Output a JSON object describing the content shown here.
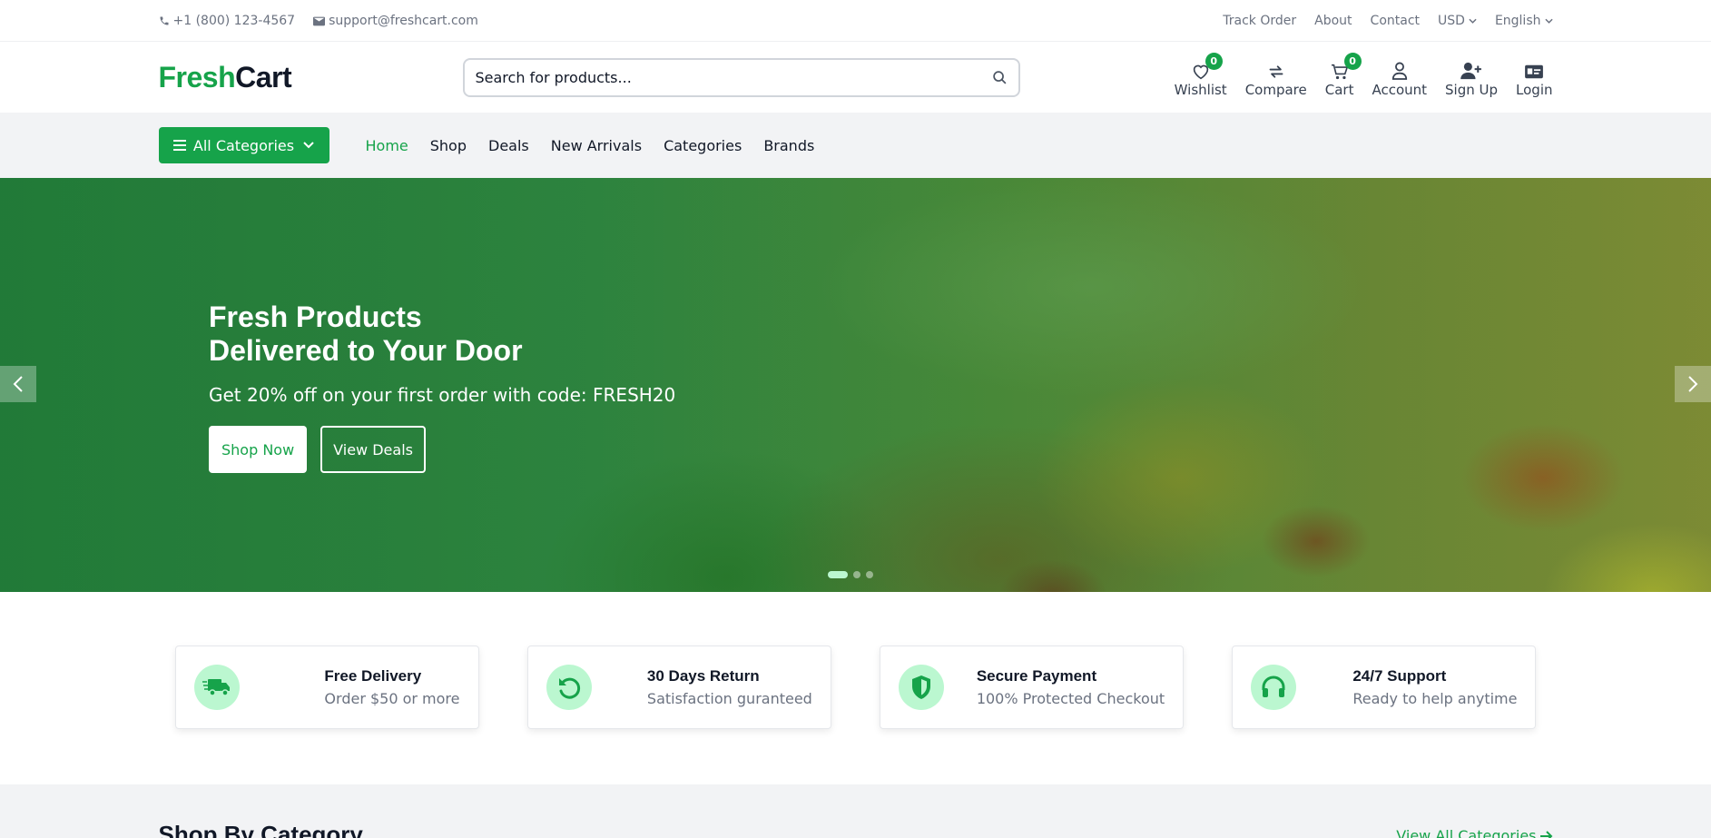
{
  "topbar": {
    "phone": "+1 (800) 123-4567",
    "email": "support@freshcart.com",
    "links": [
      "Track Order",
      "About",
      "Contact"
    ],
    "currency": "USD",
    "language": "English"
  },
  "header": {
    "logo_part1": "Fresh",
    "logo_part2": "Cart",
    "search_placeholder": "Search for products...",
    "icons": {
      "wishlist": {
        "label": "Wishlist",
        "count": "0"
      },
      "compare": {
        "label": "Compare"
      },
      "cart": {
        "label": "Cart",
        "count": "0"
      },
      "account": {
        "label": "Account"
      },
      "signup": {
        "label": "Sign Up"
      },
      "login": {
        "label": "Login"
      }
    }
  },
  "nav": {
    "all_categories": "All Categories",
    "links": [
      "Home",
      "Shop",
      "Deals",
      "New Arrivals",
      "Categories",
      "Brands"
    ],
    "active": "Home"
  },
  "hero": {
    "title_line1": "Fresh Products",
    "title_line2": "Delivered to Your Door",
    "subtitle": "Get 20% off on your first order with code: FRESH20",
    "primary_button": "Shop Now",
    "secondary_button": "View Deals",
    "slides": 3,
    "active_slide": 1
  },
  "features": [
    {
      "icon": "truck-icon",
      "title": "Free Delivery",
      "subtitle": "Order $50 or more"
    },
    {
      "icon": "return-icon",
      "title": "30 Days Return",
      "subtitle": "Satisfaction guranteed"
    },
    {
      "icon": "shield-icon",
      "title": "Secure Payment",
      "subtitle": "100% Protected Checkout"
    },
    {
      "icon": "headset-icon",
      "title": "24/7 Support",
      "subtitle": "Ready to help anytime"
    }
  ],
  "shop_by_category": {
    "title": "Shop By Category",
    "view_all": "View All Categories"
  },
  "colors": {
    "brand": "#16a34a",
    "brand_light": "#bbf7d0",
    "nav_bg": "#f2f3f5"
  }
}
